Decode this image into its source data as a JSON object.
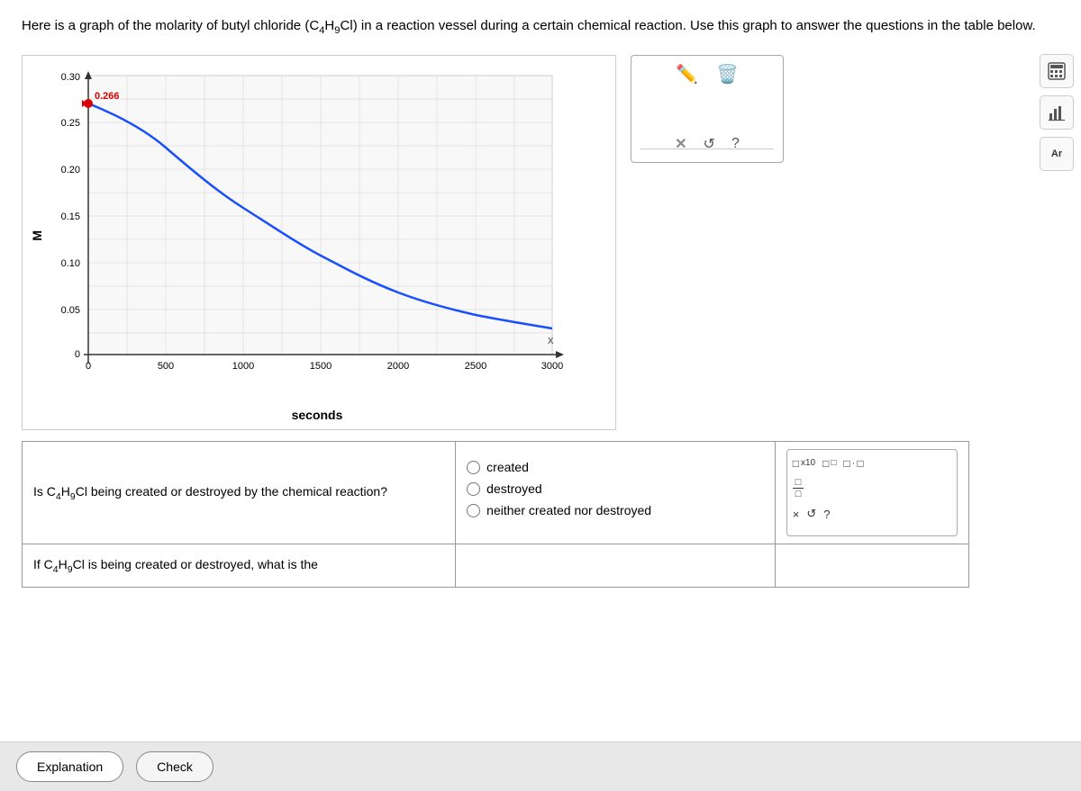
{
  "page": {
    "intro": {
      "line1": "Here is a graph of the molarity of butyl chloride",
      "formula": "(C₄H₉Cl)",
      "line2": "in a reaction vessel during a certain chemical reaction. Use this graph to answer the questions in the table below."
    },
    "graph": {
      "y_label": "M",
      "x_label": "seconds",
      "y_axis": [
        0,
        0.05,
        0.1,
        0.15,
        0.2,
        0.25,
        0.3
      ],
      "x_axis": [
        0,
        500,
        1000,
        1500,
        2000,
        2500,
        3000
      ],
      "point_label": "0.266",
      "point_y": "0.266"
    },
    "question1": {
      "text": "Is C₄H₉Cl being created or destroyed by the chemical reaction?",
      "options": [
        "created",
        "destroyed",
        "neither created nor destroyed"
      ]
    },
    "question2": {
      "text": "If C₄H₉Cl is being created or destroyed, what is the"
    },
    "footer": {
      "explanation_label": "Explanation",
      "check_label": "Check"
    },
    "sidebar": {
      "calculator_icon": "📊",
      "bar_chart_icon": "📈",
      "ar_label": "Ar"
    },
    "math_tools": {
      "x10_label": "x10",
      "times_label": "·",
      "fraction_num": "□",
      "fraction_den": "□",
      "x_btn": "×",
      "undo_btn": "↺",
      "help_btn": "?"
    }
  }
}
